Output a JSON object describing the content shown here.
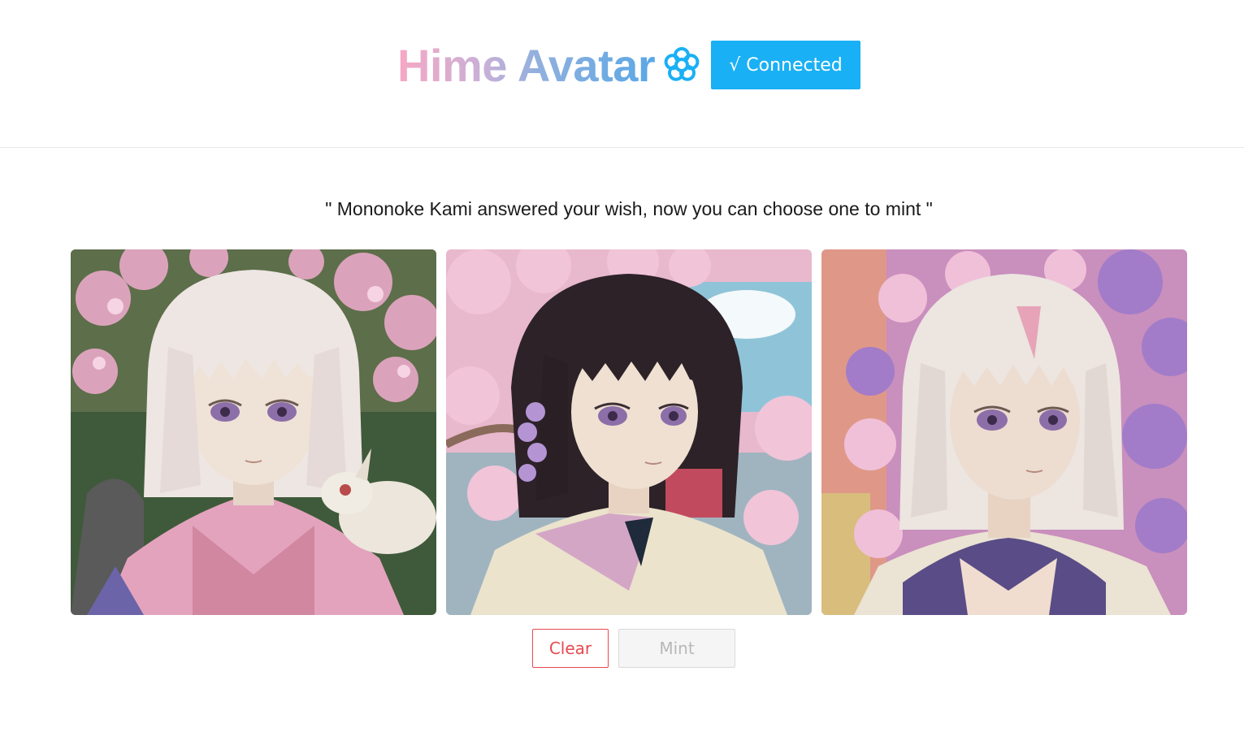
{
  "header": {
    "title": "Hime Avatar",
    "title_icon": "flower-icon",
    "connect_label": "√ Connected",
    "accent_color": "#1ab0f5"
  },
  "main": {
    "tagline": "\" Mononoke Kami answered your wish, now you can choose one to mint \"",
    "avatars": [
      {
        "hair": "white",
        "hair_color": "#eee6e2",
        "bg_color": "#3f5a3a",
        "robe_color": "#e3a3bd",
        "companion": "white-rabbit"
      },
      {
        "hair": "black",
        "hair_color": "#2d2228",
        "bg_color": "#e8b8cc",
        "robe_color": "#d4a6c6",
        "companion": "none"
      },
      {
        "hair": "white",
        "hair_color": "#ece5e0",
        "bg_color": "#c98fbd",
        "robe_color": "#5a4c86",
        "companion": "none"
      }
    ],
    "clear_label": "Clear",
    "mint_label": "Mint",
    "danger_color": "#e6494f"
  }
}
